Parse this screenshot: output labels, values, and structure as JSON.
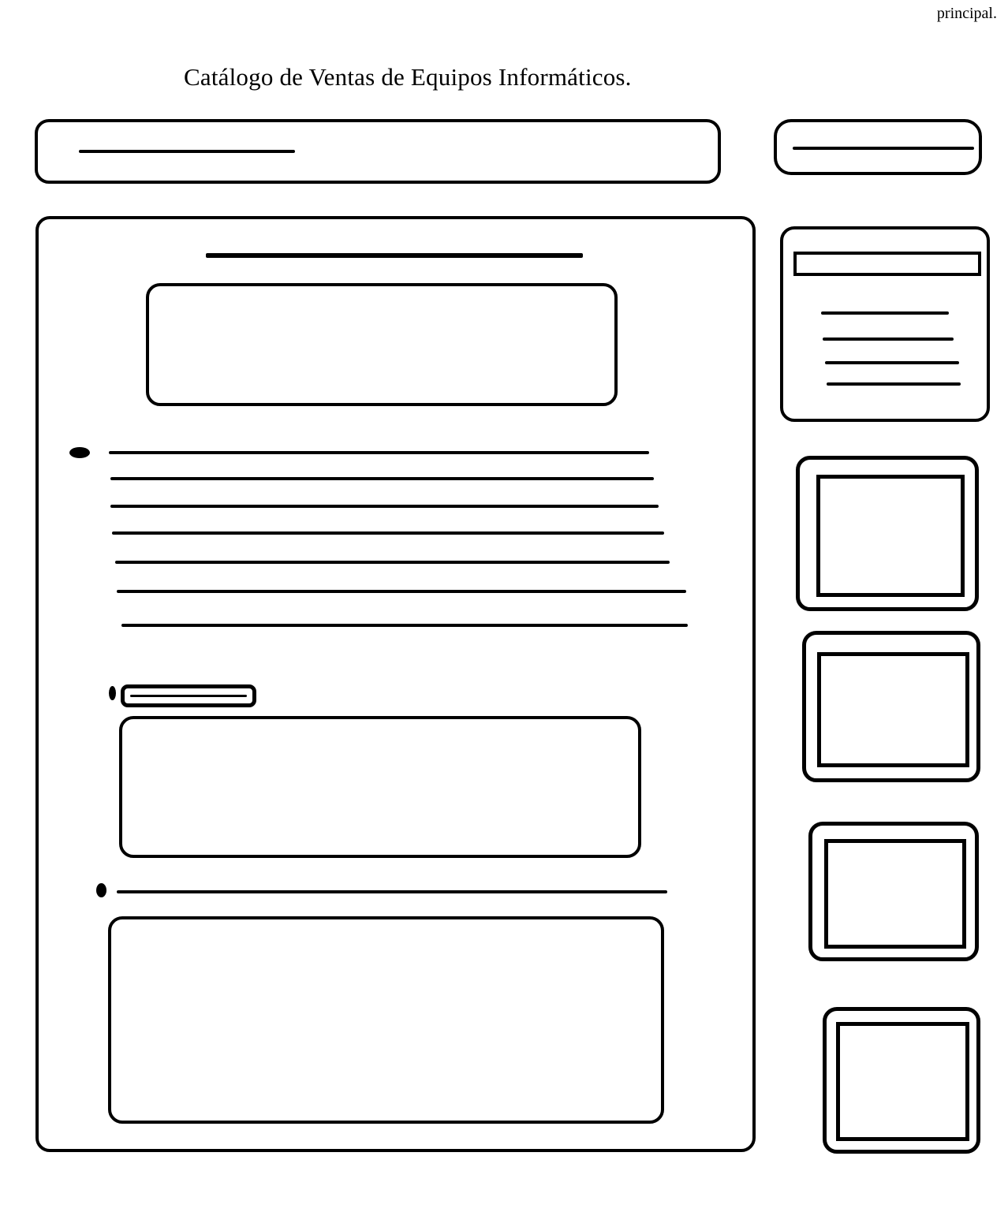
{
  "header": {
    "corner_label": "principal.",
    "title": "Catálogo de Ventas de Equipos Informáticos."
  },
  "colors": {
    "stroke": "#000000",
    "background": "#ffffff"
  }
}
